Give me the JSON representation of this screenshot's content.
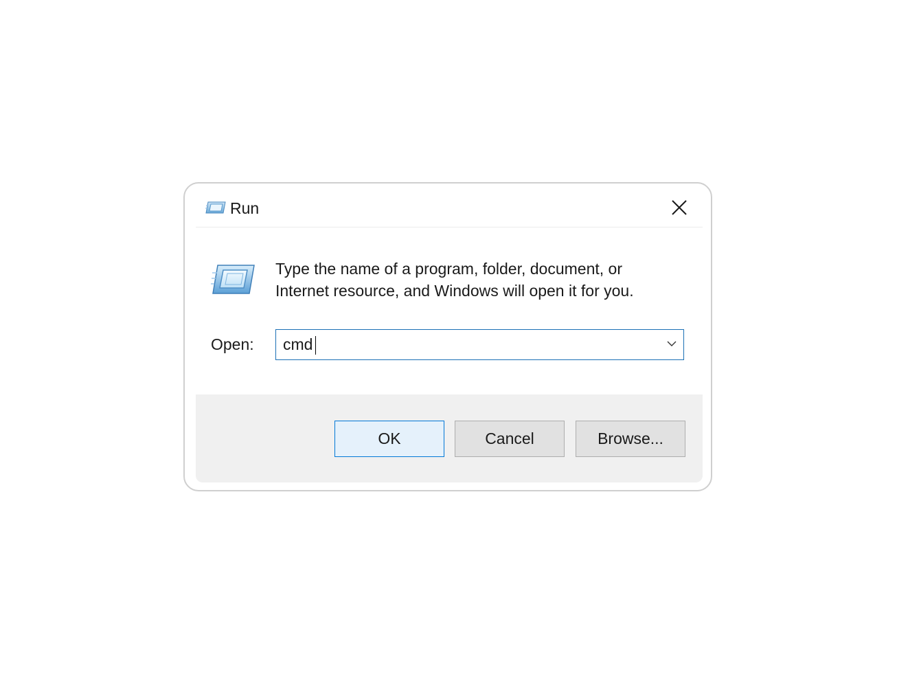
{
  "window": {
    "title": "Run",
    "title_icon": "run-icon",
    "close_icon": "close-icon"
  },
  "content": {
    "icon": "run-icon",
    "description_line1": "Type the name of a program, folder, document, or",
    "description_line2": "Internet resource, and Windows will open it for you.",
    "open_label": "Open:",
    "open_value": "cmd",
    "dropdown_icon": "chevron-down-icon"
  },
  "buttons": {
    "ok": "OK",
    "cancel": "Cancel",
    "browse": "Browse..."
  },
  "colors": {
    "accent": "#0078d7",
    "ok_background": "#e5f1fb",
    "button_background": "#e1e1e1",
    "footer_background": "#f0f0f0"
  }
}
